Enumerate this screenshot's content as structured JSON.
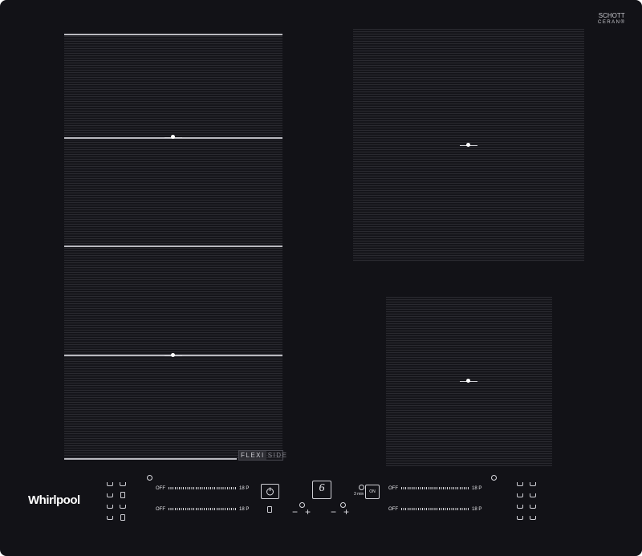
{
  "brand": "Whirlpool",
  "glass_brand": {
    "line1": "SCHOTT",
    "line2": "CERAN®"
  },
  "flexi_badge": {
    "part1": "FLEXI",
    "part2": "SIDE"
  },
  "left_controls": {
    "top_row": {
      "off_label": "OFF",
      "max_label": "18 P"
    },
    "bottom_row": {
      "off_label": "OFF",
      "max_label": "18 P"
    }
  },
  "right_controls": {
    "top_row": {
      "off_label": "OFF",
      "max_label": "18 P"
    },
    "bottom_row": {
      "off_label": "OFF",
      "max_label": "18 P"
    }
  },
  "center_controls": {
    "power_icon": "power-icon",
    "sixth_sense_digit": "6",
    "minus_symbol": "−",
    "plus_symbol": "+",
    "timer_prefix": "3 min",
    "on_label": "ON"
  },
  "colors": {
    "glass": "#121217",
    "zone_line": "#b9b9bf",
    "text": "#e6e6ea"
  }
}
